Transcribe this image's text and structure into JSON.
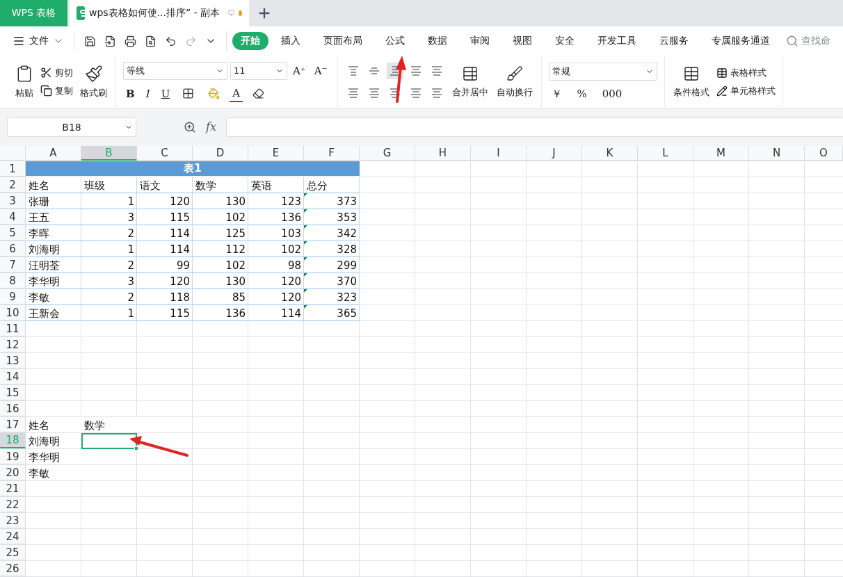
{
  "app_tab": "WPS 表格",
  "doc_tab": {
    "title": "wps表格如何使...排序”  - 副本",
    "modified": true
  },
  "menu": {
    "file": "文件",
    "tabs": [
      {
        "label": "开始",
        "selected": true
      },
      {
        "label": "插入",
        "selected": false
      },
      {
        "label": "页面布局",
        "selected": false
      },
      {
        "label": "公式",
        "selected": false
      },
      {
        "label": "数据",
        "selected": false
      },
      {
        "label": "审阅",
        "selected": false
      },
      {
        "label": "视图",
        "selected": false
      },
      {
        "label": "安全",
        "selected": false
      },
      {
        "label": "开发工具",
        "selected": false
      },
      {
        "label": "云服务",
        "selected": false
      },
      {
        "label": "专属服务通道",
        "selected": false
      }
    ],
    "search": "查找命"
  },
  "ribbon": {
    "clipboard": {
      "paste": "粘贴",
      "cut": "剪切",
      "copy": "复制",
      "format_painter": "格式刷"
    },
    "font": {
      "name": "等线",
      "size": "11",
      "size_buttons": [
        "A⁺",
        "A⁻"
      ],
      "style_buttons": [
        "B",
        "I",
        "U"
      ],
      "color_button": "A"
    },
    "alignment": {
      "vertical": [
        {
          "selected": false
        },
        {
          "selected": false
        },
        {
          "selected": true
        }
      ],
      "merge": "合并居中",
      "wrap": "自动换行"
    },
    "number": {
      "format": "常规",
      "symbols": [
        "￥",
        "%",
        "000"
      ]
    },
    "styles": {
      "conditional": "条件格式",
      "table_style": "表格样式",
      "cell_style": "单元格样式"
    }
  },
  "formula_bar": {
    "cell_ref": "B18",
    "fx": "fx"
  },
  "columns": [
    {
      "label": "A",
      "selected": false
    },
    {
      "label": "B",
      "selected": true
    },
    {
      "label": "C",
      "selected": false
    },
    {
      "label": "D",
      "selected": false
    },
    {
      "label": "E",
      "selected": false
    },
    {
      "label": "F",
      "selected": false
    },
    {
      "label": "G",
      "selected": false
    },
    {
      "label": "H",
      "selected": false
    },
    {
      "label": "I",
      "selected": false
    },
    {
      "label": "J",
      "selected": false
    },
    {
      "label": "K",
      "selected": false
    },
    {
      "label": "L",
      "selected": false
    },
    {
      "label": "M",
      "selected": false
    },
    {
      "label": "N",
      "selected": false
    },
    {
      "label": "O",
      "selected": false
    }
  ],
  "rows": [
    {
      "number": "1",
      "selected": false,
      "kind": "title",
      "title": "表1"
    },
    {
      "number": "2",
      "selected": false,
      "kind": "table",
      "cells": [
        {
          "text": "姓名",
          "kind": "text"
        },
        {
          "text": "班级",
          "kind": "text"
        },
        {
          "text": "语文",
          "kind": "text"
        },
        {
          "text": "数学",
          "kind": "text"
        },
        {
          "text": "英语",
          "kind": "text"
        },
        {
          "text": "总分",
          "kind": "text"
        }
      ]
    },
    {
      "number": "3",
      "selected": false,
      "kind": "table",
      "cells": [
        {
          "text": "张珊",
          "kind": "text"
        },
        {
          "text": "1",
          "kind": "number"
        },
        {
          "text": "120",
          "kind": "number"
        },
        {
          "text": "130",
          "kind": "number"
        },
        {
          "text": "123",
          "kind": "number"
        },
        {
          "text": "373",
          "kind": "flagged"
        }
      ]
    },
    {
      "number": "4",
      "selected": false,
      "kind": "table",
      "cells": [
        {
          "text": "王五",
          "kind": "text"
        },
        {
          "text": "3",
          "kind": "number"
        },
        {
          "text": "115",
          "kind": "number"
        },
        {
          "text": "102",
          "kind": "number"
        },
        {
          "text": "136",
          "kind": "number"
        },
        {
          "text": "353",
          "kind": "flagged"
        }
      ]
    },
    {
      "number": "5",
      "selected": false,
      "kind": "table",
      "cells": [
        {
          "text": "李晖",
          "kind": "text"
        },
        {
          "text": "2",
          "kind": "number"
        },
        {
          "text": "114",
          "kind": "number"
        },
        {
          "text": "125",
          "kind": "number"
        },
        {
          "text": "103",
          "kind": "number"
        },
        {
          "text": "342",
          "kind": "flagged"
        }
      ]
    },
    {
      "number": "6",
      "selected": false,
      "kind": "table",
      "cells": [
        {
          "text": "刘海明",
          "kind": "text"
        },
        {
          "text": "1",
          "kind": "number"
        },
        {
          "text": "114",
          "kind": "number"
        },
        {
          "text": "112",
          "kind": "number"
        },
        {
          "text": "102",
          "kind": "number"
        },
        {
          "text": "328",
          "kind": "flagged"
        }
      ]
    },
    {
      "number": "7",
      "selected": false,
      "kind": "table",
      "cells": [
        {
          "text": "汪明荃",
          "kind": "text"
        },
        {
          "text": "2",
          "kind": "number"
        },
        {
          "text": "99",
          "kind": "number"
        },
        {
          "text": "102",
          "kind": "number"
        },
        {
          "text": "98",
          "kind": "number"
        },
        {
          "text": "299",
          "kind": "flagged"
        }
      ]
    },
    {
      "number": "8",
      "selected": false,
      "kind": "table",
      "cells": [
        {
          "text": "李华明",
          "kind": "text"
        },
        {
          "text": "3",
          "kind": "number"
        },
        {
          "text": "120",
          "kind": "number"
        },
        {
          "text": "130",
          "kind": "number"
        },
        {
          "text": "120",
          "kind": "number"
        },
        {
          "text": "370",
          "kind": "flagged"
        }
      ]
    },
    {
      "number": "9",
      "selected": false,
      "kind": "table",
      "cells": [
        {
          "text": "李敏",
          "kind": "text"
        },
        {
          "text": "2",
          "kind": "number"
        },
        {
          "text": "118",
          "kind": "number"
        },
        {
          "text": "85",
          "kind": "number"
        },
        {
          "text": "120",
          "kind": "number"
        },
        {
          "text": "323",
          "kind": "flagged"
        }
      ]
    },
    {
      "number": "10",
      "selected": false,
      "kind": "table",
      "cells": [
        {
          "text": "王新会",
          "kind": "text"
        },
        {
          "text": "1",
          "kind": "number"
        },
        {
          "text": "115",
          "kind": "number"
        },
        {
          "text": "136",
          "kind": "number"
        },
        {
          "text": "114",
          "kind": "number"
        },
        {
          "text": "365",
          "kind": "flagged"
        }
      ]
    },
    {
      "number": "11",
      "selected": false,
      "kind": "plain"
    },
    {
      "number": "12",
      "selected": false,
      "kind": "plain"
    },
    {
      "number": "13",
      "selected": false,
      "kind": "plain"
    },
    {
      "number": "14",
      "selected": false,
      "kind": "plain"
    },
    {
      "number": "15",
      "selected": false,
      "kind": "plain"
    },
    {
      "number": "16",
      "selected": false,
      "kind": "plain"
    },
    {
      "number": "17",
      "selected": false,
      "kind": "plain",
      "cells": [
        {
          "text": "姓名",
          "kind": "text"
        },
        {
          "text": "数学",
          "kind": "text"
        }
      ]
    },
    {
      "number": "18",
      "selected": true,
      "kind": "plain",
      "cells": [
        {
          "text": "刘海明",
          "kind": "text"
        },
        {
          "kind": "active"
        }
      ]
    },
    {
      "number": "19",
      "selected": false,
      "kind": "plain",
      "cells": [
        {
          "text": "李华明",
          "kind": "text"
        }
      ]
    },
    {
      "number": "20",
      "selected": false,
      "kind": "plain",
      "cells": [
        {
          "text": "李敏",
          "kind": "text"
        }
      ]
    },
    {
      "number": "21",
      "selected": false,
      "kind": "plain"
    },
    {
      "number": "22",
      "selected": false,
      "kind": "plain"
    },
    {
      "number": "23",
      "selected": false,
      "kind": "plain"
    },
    {
      "number": "24",
      "selected": false,
      "kind": "plain"
    },
    {
      "number": "25",
      "selected": false,
      "kind": "plain"
    },
    {
      "number": "26",
      "selected": false,
      "kind": "plain"
    }
  ],
  "annotations": [
    {
      "kind": "arrow"
    },
    {
      "kind": "arrow"
    }
  ]
}
